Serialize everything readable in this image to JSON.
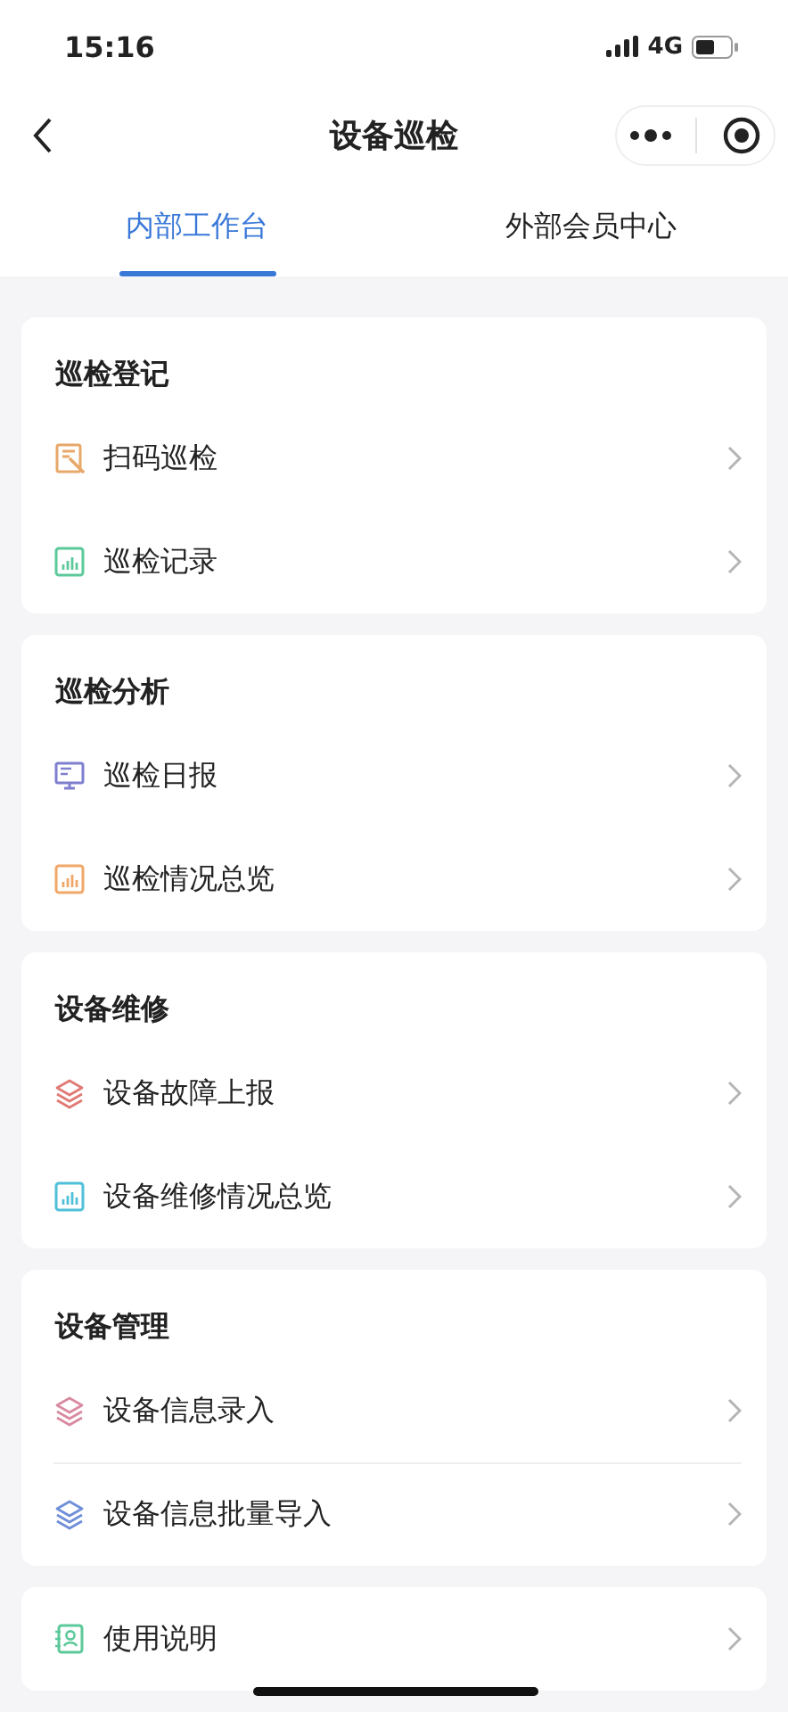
{
  "status_bar": {
    "time": "15:16",
    "network": "4G"
  },
  "nav": {
    "title": "设备巡检"
  },
  "tabs": [
    {
      "label": "内部工作台",
      "selected": true
    },
    {
      "label": "外部会员中心",
      "selected": false
    }
  ],
  "sections": [
    {
      "title": "巡检登记",
      "dividers": false,
      "items": [
        {
          "label": "扫码巡检",
          "kind": "scan",
          "color": "#e8a86a"
        },
        {
          "label": "巡检记录",
          "kind": "chart",
          "color": "#5cc99a"
        }
      ]
    },
    {
      "title": "巡检分析",
      "dividers": false,
      "items": [
        {
          "label": "巡检日报",
          "kind": "monitor",
          "color": "#7f7fd0"
        },
        {
          "label": "巡检情况总览",
          "kind": "chart",
          "color": "#f0a868"
        }
      ]
    },
    {
      "title": "设备维修",
      "dividers": false,
      "items": [
        {
          "label": "设备故障上报",
          "kind": "layers",
          "color": "#e07a74"
        },
        {
          "label": "设备维修情况总览",
          "kind": "chart",
          "color": "#4fc0d8"
        }
      ]
    },
    {
      "title": "设备管理",
      "dividers": true,
      "items": [
        {
          "label": "设备信息录入",
          "kind": "layers",
          "color": "#d98aa0"
        },
        {
          "label": "设备信息批量导入",
          "kind": "layers",
          "color": "#6f8fd8"
        }
      ]
    },
    {
      "items": [
        {
          "label": "使用说明",
          "kind": "contact",
          "color": "#5cc99a"
        }
      ]
    }
  ]
}
